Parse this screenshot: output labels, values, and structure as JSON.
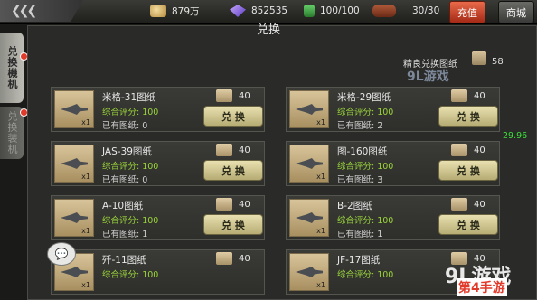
{
  "topbar": {
    "gold": "879万",
    "gems": "852535",
    "fuel": "100/100",
    "ammo": "30/30",
    "recharge": "充值",
    "mall": "商城"
  },
  "sidebar": {
    "tab1": "兑换機机",
    "tab2": "兑换装机"
  },
  "header": {
    "title": "兑换",
    "crafts_label": "精良兑换图纸",
    "crafts_count": "58"
  },
  "cards": [
    {
      "name": "米格-31图纸",
      "score": "综合评分: 100",
      "owned": "已有图纸: 0",
      "cost": "40",
      "button": "兑 换",
      "qty": "x1"
    },
    {
      "name": "米格-29图纸",
      "score": "综合评分: 100",
      "owned": "已有图纸: 2",
      "cost": "40",
      "button": "兑 换",
      "qty": "x1"
    },
    {
      "name": "JAS-39图纸",
      "score": "综合评分: 100",
      "owned": "已有图纸: 0",
      "cost": "40",
      "button": "兑 换",
      "qty": "x1"
    },
    {
      "name": "图-160图纸",
      "score": "综合评分: 100",
      "owned": "已有图纸: 3",
      "cost": "40",
      "button": "兑 换",
      "qty": "x1"
    },
    {
      "name": "A-10图纸",
      "score": "综合评分: 100",
      "owned": "已有图纸: 1",
      "cost": "40",
      "button": "兑 换",
      "qty": "x1"
    },
    {
      "name": "B-2图纸",
      "score": "综合评分: 100",
      "owned": "已有图纸: 1",
      "cost": "40",
      "button": "兑 换",
      "qty": "x1"
    },
    {
      "name": "歼-11图纸",
      "score": "综合评分: 100",
      "owned": "",
      "cost": "40",
      "button": "",
      "qty": "x1"
    },
    {
      "name": "JF-17图纸",
      "score": "综合评分: 100",
      "owned": "",
      "cost": "40",
      "button": "",
      "qty": "x1"
    }
  ],
  "fps": "29.96",
  "watermarks": {
    "wm1": "9L游戏",
    "wm2": "9L游戏",
    "wm3": "第4手游"
  },
  "icons": {
    "back": "double-chevron-left-icon",
    "gold": "gold-icon",
    "gem": "gem-icon",
    "fuel": "fuel-icon",
    "ammo": "ammo-icon",
    "blueprint": "blueprint-icon",
    "chat": "chat-icon"
  }
}
